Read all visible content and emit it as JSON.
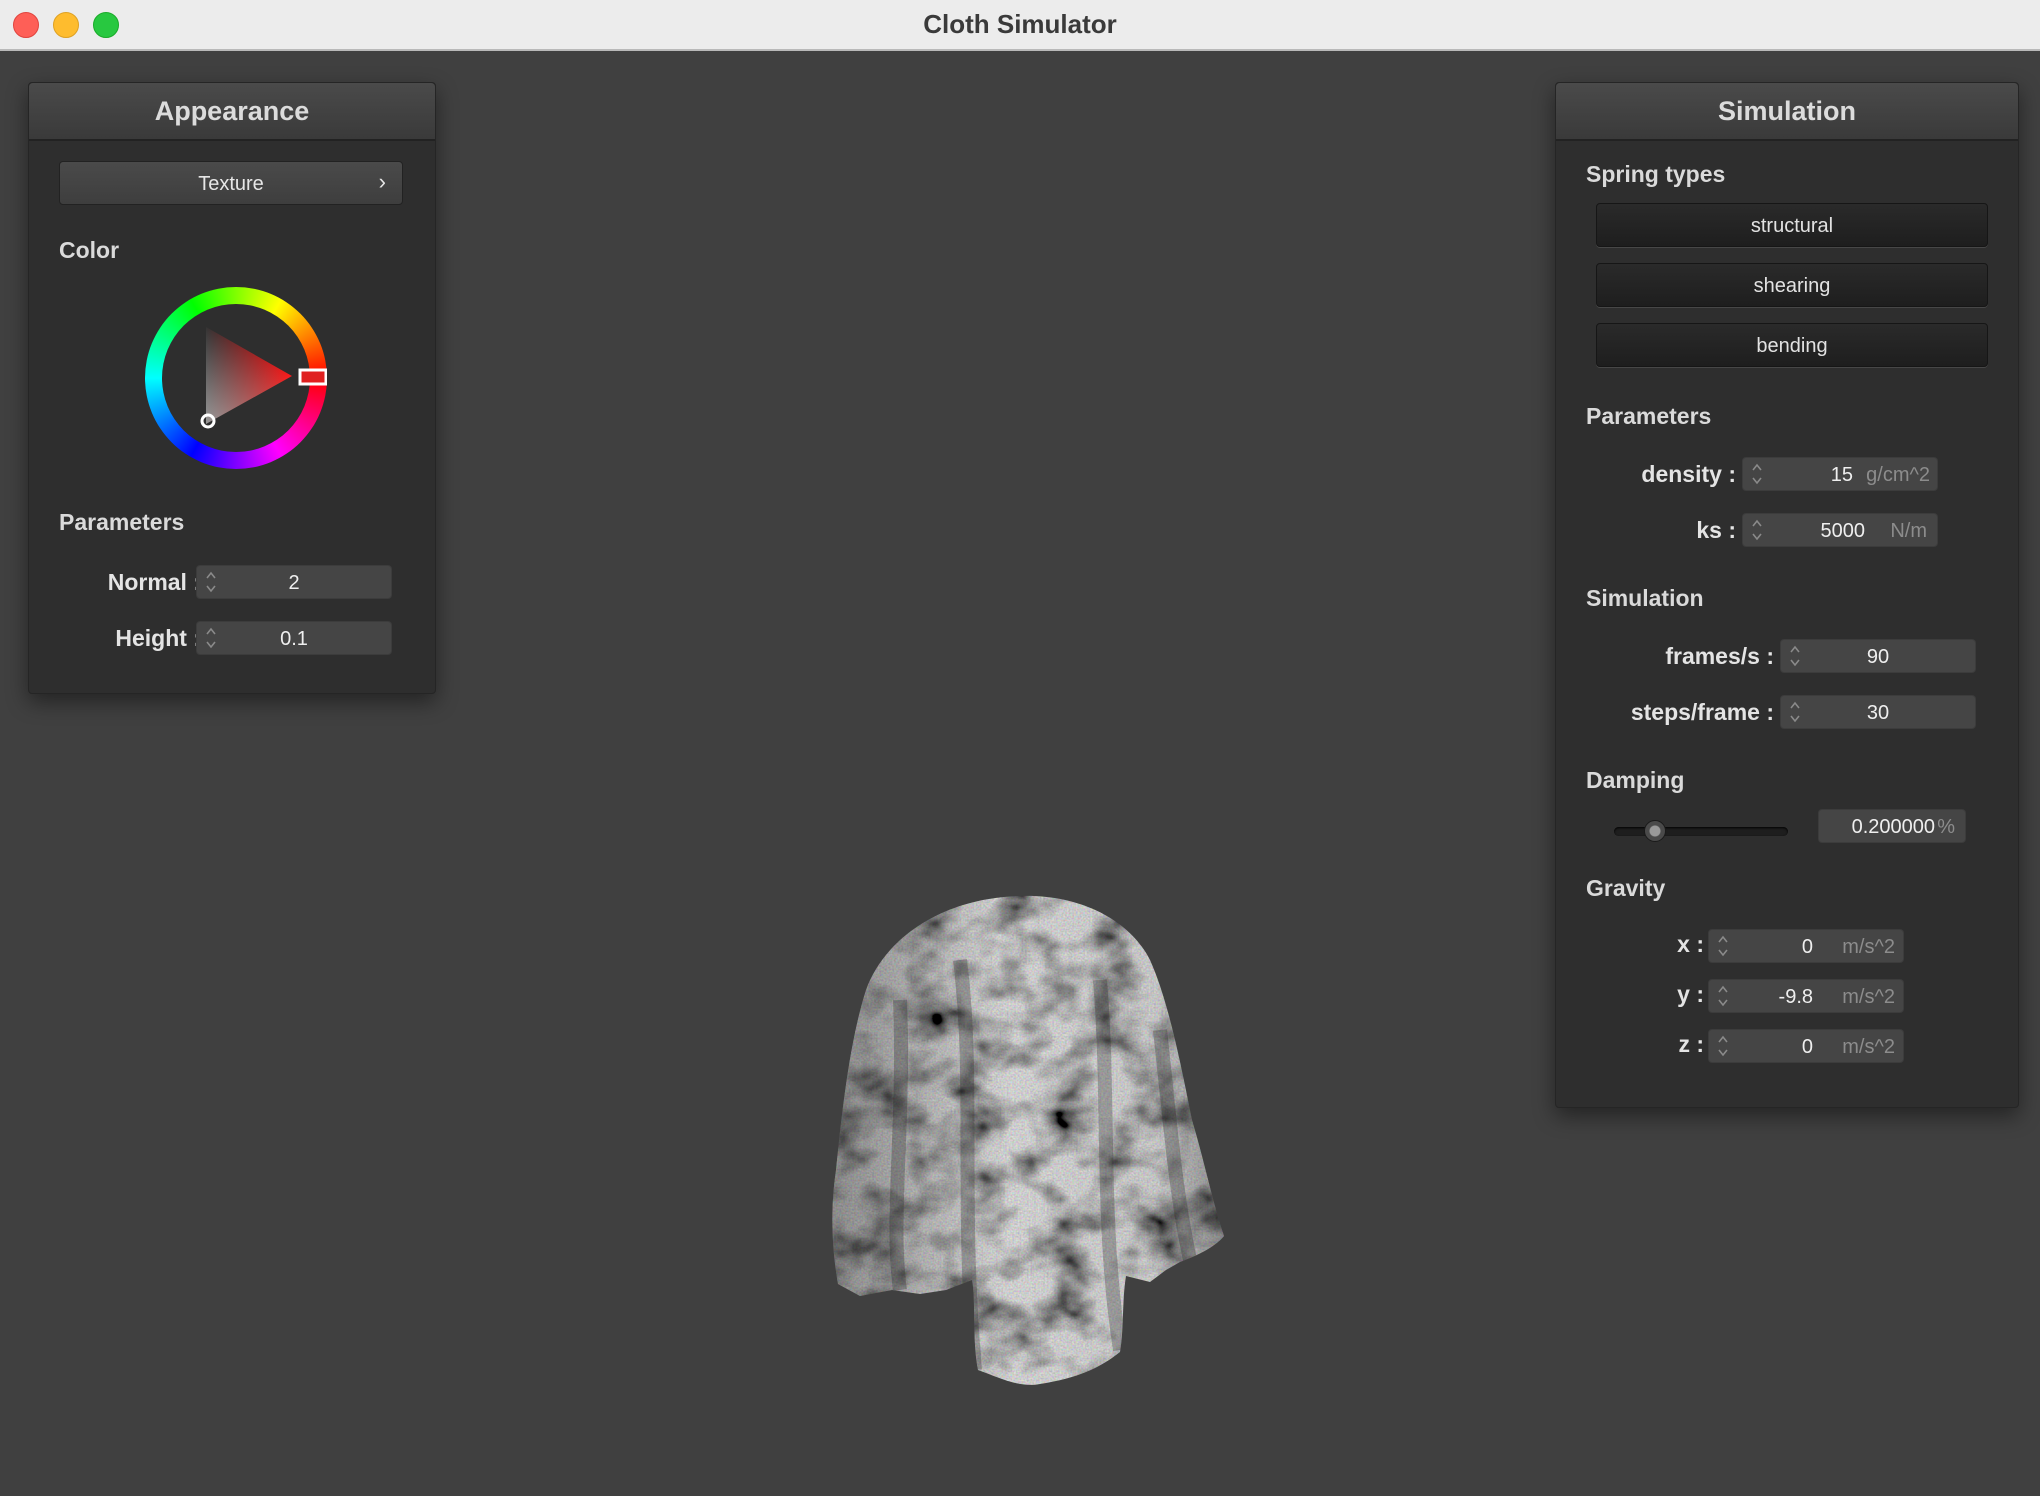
{
  "window": {
    "title": "Cloth Simulator"
  },
  "appearance": {
    "title": "Appearance",
    "texture_button": "Texture",
    "texture_chevron": "›",
    "color_label": "Color",
    "color_picker_icon": "color-wheel-icon",
    "parameters_label": "Parameters",
    "normal": {
      "label": "Normal :",
      "value": "2"
    },
    "height": {
      "label": "Height :",
      "value": "0.1"
    }
  },
  "simulation_panel": {
    "title": "Simulation",
    "spring_types_label": "Spring types",
    "spring_buttons": [
      "structural",
      "shearing",
      "bending"
    ],
    "parameters_label": "Parameters",
    "density": {
      "label": "density :",
      "value": "15",
      "unit": "g/cm^2"
    },
    "ks": {
      "label": "ks :",
      "value": "5000",
      "unit": "N/m"
    },
    "simulation_label": "Simulation",
    "frames_per_s": {
      "label": "frames/s :",
      "value": "90"
    },
    "steps_per_frame": {
      "label": "steps/frame :",
      "value": "30"
    },
    "damping_label": "Damping",
    "damping": {
      "value": "0.200000",
      "unit": "%",
      "slider_fraction": 0.2
    },
    "gravity_label": "Gravity",
    "gravity": {
      "x": {
        "label": "x :",
        "value": "0",
        "unit": "m/s^2"
      },
      "y": {
        "label": "y :",
        "value": "-9.8",
        "unit": "m/s^2"
      },
      "z": {
        "label": "z :",
        "value": "0",
        "unit": "m/s^2"
      }
    }
  },
  "viewport": {
    "object_icon": "draped-cloth-icon"
  }
}
